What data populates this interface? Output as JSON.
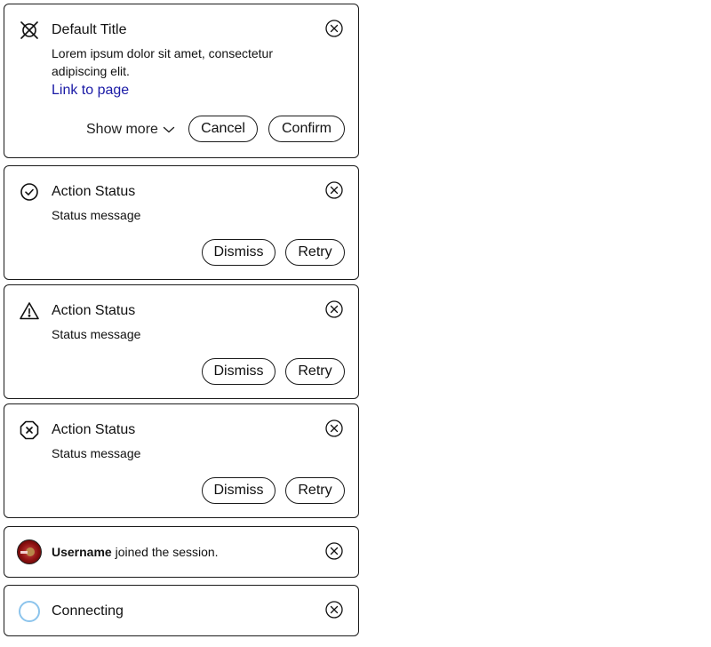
{
  "default_notification": {
    "title": "Default Title",
    "message": "Lorem ipsum dolor sit amet, consectetur adipiscing elit.",
    "link_text": "Link to page",
    "show_more_label": "Show more",
    "cancel_label": "Cancel",
    "confirm_label": "Confirm",
    "icon": "no-symbol-icon"
  },
  "status_notifications": [
    {
      "title": "Action Status",
      "message": "Status message",
      "dismiss_label": "Dismiss",
      "retry_label": "Retry",
      "icon": "check-circle-icon"
    },
    {
      "title": "Action Status",
      "message": "Status message",
      "dismiss_label": "Dismiss",
      "retry_label": "Retry",
      "icon": "warning-triangle-icon"
    },
    {
      "title": "Action Status",
      "message": "Status message",
      "dismiss_label": "Dismiss",
      "retry_label": "Retry",
      "icon": "error-octagon-icon"
    }
  ],
  "join_notification": {
    "username": "Username",
    "text": "joined the session."
  },
  "connecting_notification": {
    "title": "Connecting"
  },
  "colors": {
    "border": "#1a1a1a",
    "link": "#1a1aa6",
    "spinner": "#8cc4ec"
  }
}
